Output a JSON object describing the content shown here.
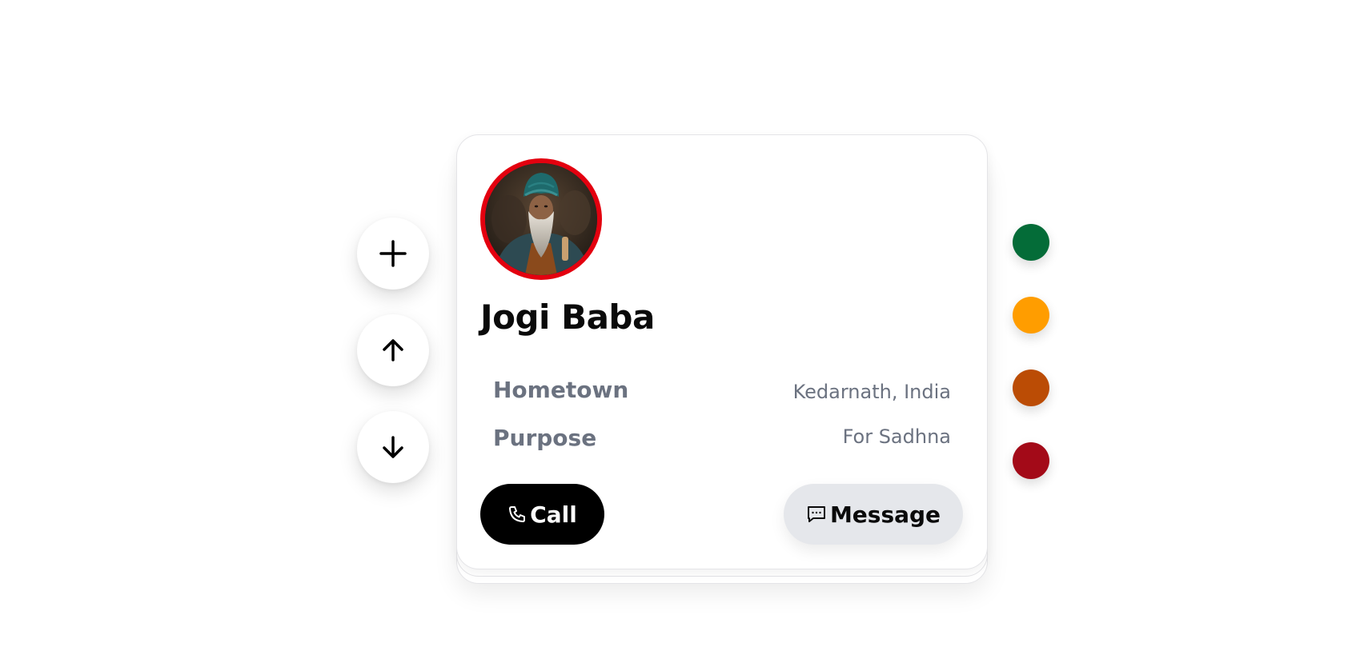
{
  "profile": {
    "name": "Jogi Baba",
    "avatar_alt": "Portrait of an elderly man with a teal turban and long white beard",
    "avatar_ring_color": "#e3000f",
    "details": [
      {
        "label": "Hometown",
        "value": "Kedarnath, India"
      },
      {
        "label": "Purpose",
        "value": "For Sadhna"
      }
    ]
  },
  "actions": {
    "call_label": "Call",
    "message_label": "Message"
  },
  "controls": {
    "add_icon": "plus-icon",
    "up_icon": "arrow-up-icon",
    "down_icon": "arrow-down-icon"
  },
  "swatches": [
    {
      "name": "green",
      "color": "#046c38"
    },
    {
      "name": "saffron",
      "color": "#ff9d00"
    },
    {
      "name": "burnt-orange",
      "color": "#bb4c05"
    },
    {
      "name": "crimson",
      "color": "#a30a18"
    }
  ]
}
